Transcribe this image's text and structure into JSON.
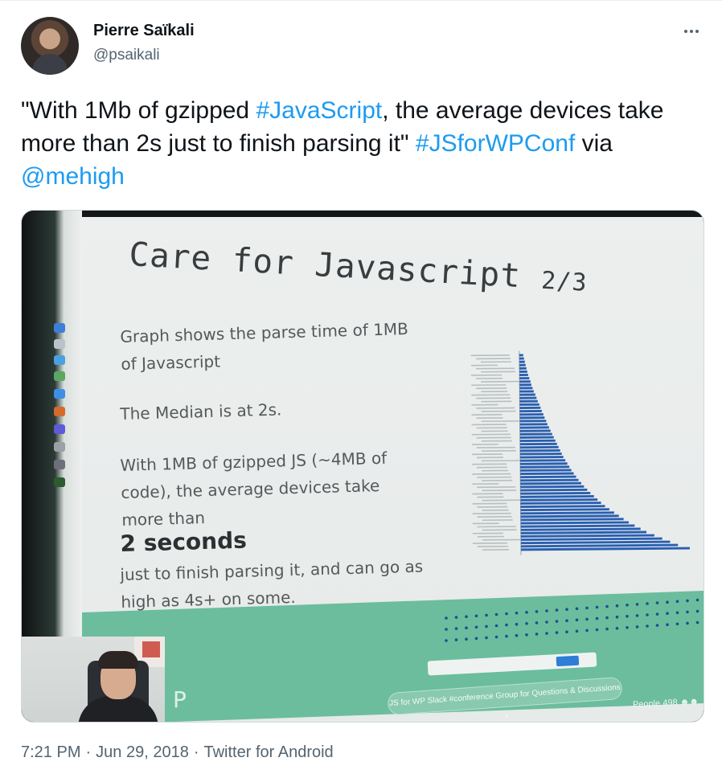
{
  "author": {
    "display_name": "Pierre Saïkali",
    "handle": "@psaikali"
  },
  "more_icon": "more-horizontal-icon",
  "tweet": {
    "segments": [
      {
        "text": "\"With 1Mb of gzipped ",
        "type": "text"
      },
      {
        "text": "#JavaScript",
        "type": "hashtag"
      },
      {
        "text": ", the average devices take more than 2s just to finish parsing it\" ",
        "type": "text"
      },
      {
        "text": "#JSforWPConf",
        "type": "hashtag"
      },
      {
        "text": " via ",
        "type": "text"
      },
      {
        "text": "@mehigh",
        "type": "mention"
      }
    ]
  },
  "slide": {
    "title_main": "Care for Javascript",
    "title_suffix": "2/3",
    "para1": "Graph shows the parse time of 1MB of Javascript",
    "para2": "The Median is at 2s.",
    "para3": "With 1MB of gzipped JS (~4MB of code), the average devices take more than",
    "highlight": "2 seconds",
    "para4": "just to finish parsing it, and can go as high as 4s+ on some.",
    "cta": "JS for WP Slack #conference Group for Questions & Discussions >",
    "people_label": "People",
    "people_count": "498",
    "logo_letter": "P"
  },
  "chart_data": {
    "type": "bar",
    "orientation": "horizontal",
    "color": "#2a5fb0",
    "values": [
      0.1,
      0.12,
      0.14,
      0.16,
      0.18,
      0.2,
      0.22,
      0.25,
      0.28,
      0.3,
      0.33,
      0.36,
      0.4,
      0.43,
      0.46,
      0.5,
      0.53,
      0.56,
      0.6,
      0.63,
      0.67,
      0.7,
      0.74,
      0.78,
      0.82,
      0.86,
      0.9,
      0.94,
      0.98,
      1.02,
      1.06,
      1.1,
      1.15,
      1.2,
      1.25,
      1.3,
      1.36,
      1.42,
      1.48,
      1.55,
      1.62,
      1.7,
      1.78,
      1.87,
      1.96,
      2.05,
      2.15,
      2.26,
      2.38,
      2.5,
      2.62,
      2.75,
      2.9,
      3.05,
      3.2,
      3.4,
      3.6,
      3.8,
      4.0,
      4.3
    ]
  },
  "meta": {
    "time": "7:21 PM",
    "date": "Jun 29, 2018",
    "source": "Twitter for Android"
  }
}
